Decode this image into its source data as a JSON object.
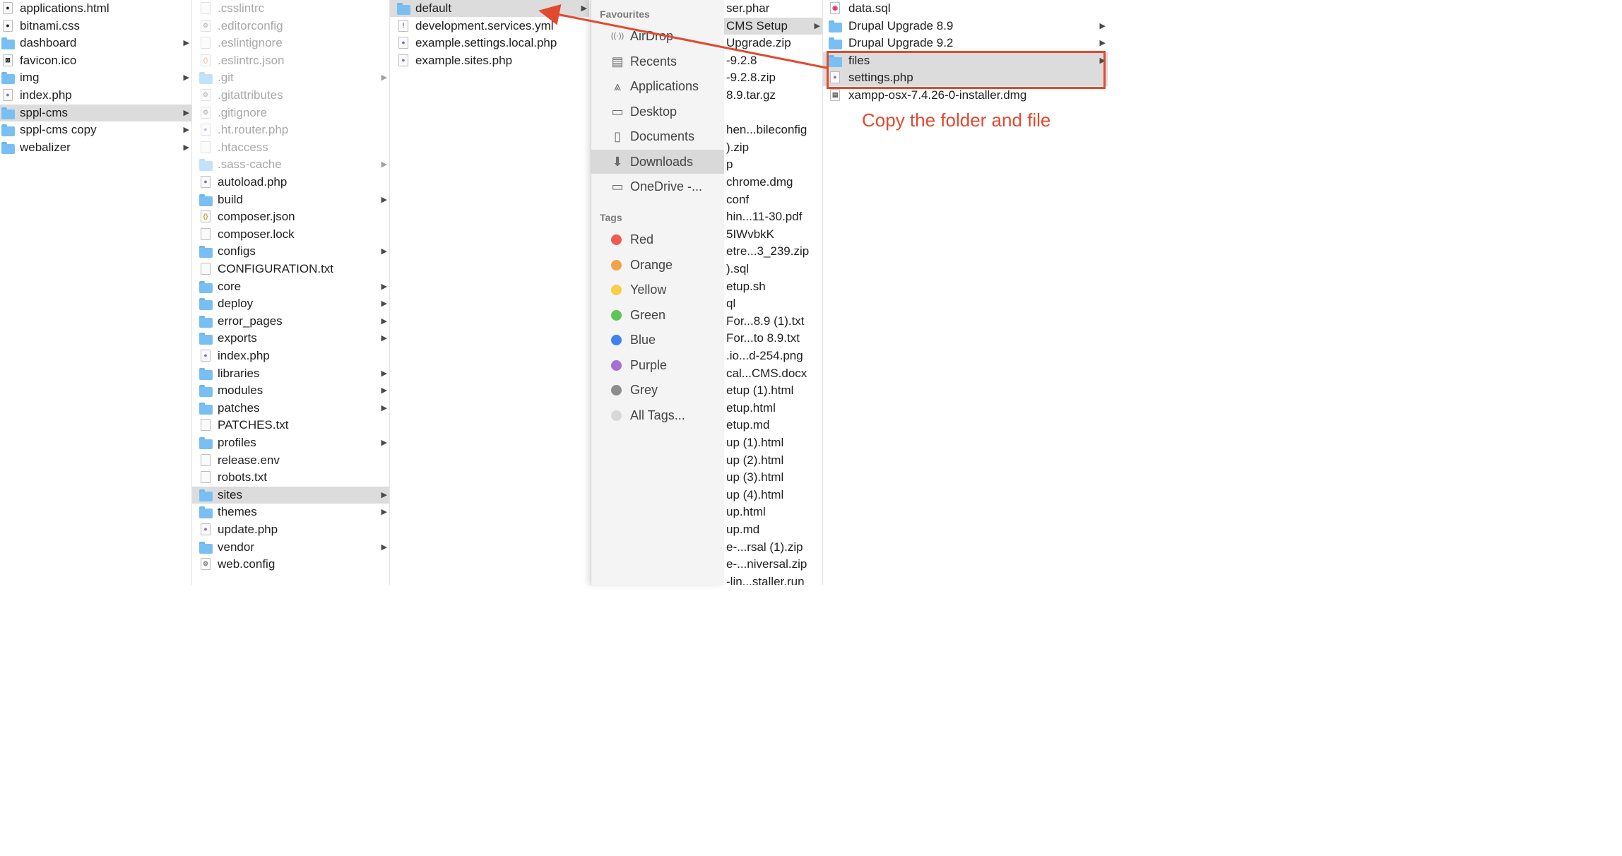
{
  "col1": [
    {
      "name": "applications.html",
      "kind": "chrome"
    },
    {
      "name": "bitnami.css",
      "kind": "css"
    },
    {
      "name": "dashboard",
      "kind": "folder",
      "arrow": true
    },
    {
      "name": "favicon.ico",
      "kind": "xampp"
    },
    {
      "name": "img",
      "kind": "folder",
      "arrow": true
    },
    {
      "name": "index.php",
      "kind": "php"
    },
    {
      "name": "sppl-cms",
      "kind": "folder",
      "arrow": true,
      "selected": true
    },
    {
      "name": "sppl-cms copy",
      "kind": "folder",
      "arrow": true
    },
    {
      "name": "webalizer",
      "kind": "folder",
      "arrow": true
    }
  ],
  "col2": [
    {
      "name": ".csslintrc",
      "kind": "file",
      "dim": true
    },
    {
      "name": ".editorconfig",
      "kind": "gear",
      "dim": true
    },
    {
      "name": ".eslintignore",
      "kind": "file",
      "dim": true
    },
    {
      "name": ".eslintrc.json",
      "kind": "json",
      "dim": true
    },
    {
      "name": ".git",
      "kind": "folder",
      "dim": true,
      "arrow": true
    },
    {
      "name": ".gitattributes",
      "kind": "gear",
      "dim": true
    },
    {
      "name": ".gitignore",
      "kind": "gear",
      "dim": true
    },
    {
      "name": ".ht.router.php",
      "kind": "php",
      "dim": true
    },
    {
      "name": ".htaccess",
      "kind": "file",
      "dim": true
    },
    {
      "name": ".sass-cache",
      "kind": "folder",
      "dim": true,
      "arrow": true
    },
    {
      "name": "autoload.php",
      "kind": "php"
    },
    {
      "name": "build",
      "kind": "folder",
      "arrow": true
    },
    {
      "name": "composer.json",
      "kind": "json"
    },
    {
      "name": "composer.lock",
      "kind": "file"
    },
    {
      "name": "configs",
      "kind": "folder",
      "arrow": true
    },
    {
      "name": "CONFIGURATION.txt",
      "kind": "file"
    },
    {
      "name": "core",
      "kind": "folder",
      "arrow": true
    },
    {
      "name": "deploy",
      "kind": "folder",
      "arrow": true
    },
    {
      "name": "error_pages",
      "kind": "folder",
      "arrow": true
    },
    {
      "name": "exports",
      "kind": "folder",
      "arrow": true
    },
    {
      "name": "index.php",
      "kind": "php"
    },
    {
      "name": "libraries",
      "kind": "folder",
      "arrow": true
    },
    {
      "name": "modules",
      "kind": "folder",
      "arrow": true
    },
    {
      "name": "patches",
      "kind": "folder",
      "arrow": true
    },
    {
      "name": "PATCHES.txt",
      "kind": "file"
    },
    {
      "name": "profiles",
      "kind": "folder",
      "arrow": true
    },
    {
      "name": "release.env",
      "kind": "file"
    },
    {
      "name": "robots.txt",
      "kind": "file"
    },
    {
      "name": "sites",
      "kind": "folder",
      "arrow": true,
      "selected": true
    },
    {
      "name": "themes",
      "kind": "folder",
      "arrow": true
    },
    {
      "name": "update.php",
      "kind": "php"
    },
    {
      "name": "vendor",
      "kind": "folder",
      "arrow": true
    },
    {
      "name": "web.config",
      "kind": "gear"
    }
  ],
  "col3": [
    {
      "name": "default",
      "kind": "folder",
      "arrow": true,
      "selected": true
    },
    {
      "name": "development.services.yml",
      "kind": "yml"
    },
    {
      "name": "example.settings.local.php",
      "kind": "php"
    },
    {
      "name": "example.sites.php",
      "kind": "php"
    }
  ],
  "sidebar": {
    "favourites_label": "Favourites",
    "favourites": [
      {
        "label": "AirDrop",
        "icon": "airdrop-icon",
        "glyph": "((·))"
      },
      {
        "label": "Recents",
        "icon": "recents-icon",
        "glyph": "▤"
      },
      {
        "label": "Applications",
        "icon": "applications-icon",
        "glyph": "⩓"
      },
      {
        "label": "Desktop",
        "icon": "desktop-icon",
        "glyph": "▭"
      },
      {
        "label": "Documents",
        "icon": "documents-icon",
        "glyph": "▯"
      },
      {
        "label": "Downloads",
        "icon": "downloads-icon",
        "glyph": "⬇",
        "selected": true
      },
      {
        "label": "OneDrive -...",
        "icon": "folder-icon",
        "glyph": "▭"
      }
    ],
    "tags_label": "Tags",
    "tags": [
      {
        "label": "Red",
        "color": "#ee5b53"
      },
      {
        "label": "Orange",
        "color": "#f0a44a"
      },
      {
        "label": "Yellow",
        "color": "#f6cf46"
      },
      {
        "label": "Green",
        "color": "#5cc657"
      },
      {
        "label": "Blue",
        "color": "#3c82f0"
      },
      {
        "label": "Purple",
        "color": "#a86fd6"
      },
      {
        "label": "Grey",
        "color": "#8d8d8d"
      },
      {
        "label": "All Tags...",
        "color": "#d8d8d8"
      }
    ]
  },
  "col5": [
    {
      "name": "ser.phar"
    },
    {
      "name": "CMS Setup",
      "selected": true,
      "arrow": true
    },
    {
      "name": "Upgrade.zip"
    },
    {
      "name": "-9.2.8"
    },
    {
      "name": "-9.2.8.zip"
    },
    {
      "name": "8.9.tar.gz"
    },
    {
      "name": ""
    },
    {
      "name": "hen...bileconfig"
    },
    {
      "name": ").zip"
    },
    {
      "name": "p"
    },
    {
      "name": "chrome.dmg"
    },
    {
      "name": "conf"
    },
    {
      "name": "hin...11-30.pdf"
    },
    {
      "name": "5IWvbkK"
    },
    {
      "name": "etre...3_239.zip"
    },
    {
      "name": ").sql"
    },
    {
      "name": "etup.sh"
    },
    {
      "name": "ql"
    },
    {
      "name": "For...8.9 (1).txt"
    },
    {
      "name": "For...to 8.9.txt"
    },
    {
      "name": ".io...d-254.png"
    },
    {
      "name": "cal...CMS.docx"
    },
    {
      "name": "etup (1).html"
    },
    {
      "name": "etup.html"
    },
    {
      "name": "etup.md"
    },
    {
      "name": "up (1).html"
    },
    {
      "name": "up (2).html"
    },
    {
      "name": "up (3).html"
    },
    {
      "name": "up (4).html"
    },
    {
      "name": "up.html"
    },
    {
      "name": "up.md"
    },
    {
      "name": "e-...rsal (1).zip"
    },
    {
      "name": "e-...niversal.zip"
    },
    {
      "name": "-lin...staller.run"
    }
  ],
  "col6": [
    {
      "name": "data.sql",
      "kind": "sql"
    },
    {
      "name": "Drupal Upgrade 8.9",
      "kind": "folder",
      "arrow": true
    },
    {
      "name": "Drupal Upgrade 9.2",
      "kind": "folder",
      "arrow": true
    },
    {
      "name": "files",
      "kind": "folder",
      "arrow": true,
      "selected": true
    },
    {
      "name": "settings.php",
      "kind": "php",
      "selected": true
    },
    {
      "name": "xampp-osx-7.4.26-0-installer.dmg",
      "kind": "dmg"
    }
  ],
  "annotation": {
    "text": "Copy the folder and file",
    "color": "#e04a2f"
  }
}
